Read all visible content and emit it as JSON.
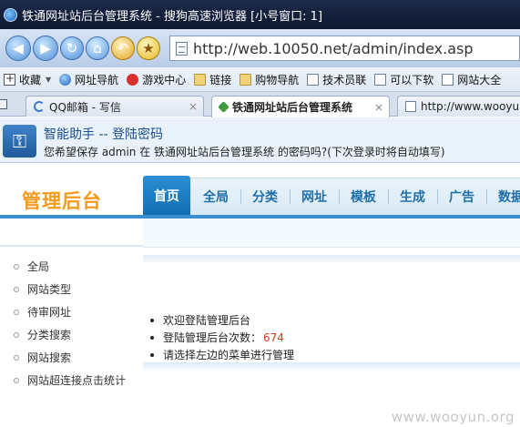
{
  "window": {
    "title": "铁通网址站后台管理系统 - 搜狗高速浏览器 [小号窗口: 1]"
  },
  "address_bar": {
    "url": "http://web.10050.net/admin/index.asp"
  },
  "bookmarks": [
    {
      "label": "收藏",
      "icon": "add-bookmark-icon"
    },
    {
      "label": "网址导航",
      "icon": "globe-icon"
    },
    {
      "label": "游戏中心",
      "icon": "game-icon"
    },
    {
      "label": "链接",
      "icon": "folder-icon"
    },
    {
      "label": "购物导航",
      "icon": "folder-icon"
    },
    {
      "label": "技术员联",
      "icon": "page-icon"
    },
    {
      "label": "可以下软",
      "icon": "page-icon"
    },
    {
      "label": "网站大全",
      "icon": "page-icon"
    }
  ],
  "tabs": [
    {
      "label": "QQ邮箱 - 写信",
      "active": false
    },
    {
      "label": "铁通网址站后台管理系统",
      "active": true
    },
    {
      "label": "http://www.wooyun.or",
      "active": false
    }
  ],
  "password_helper": {
    "title": "智能助手 -- 登陆密码",
    "message": "您希望保存 admin 在 铁通网址站后台管理系统 的密码吗?(下次登录时将自动填写)"
  },
  "admin": {
    "logo": "管理后台",
    "menu": [
      "首页",
      "全局",
      "分类",
      "网址",
      "模板",
      "生成",
      "广告",
      "数据"
    ],
    "active_menu": "首页",
    "sidebar": [
      "全局",
      "网站类型",
      "待审网址",
      "分类搜索",
      "网站搜索",
      "网站超连接点击统计"
    ],
    "info": {
      "welcome": "欢迎登陆管理后台",
      "login_count_label": "登陆管理后台次数：",
      "login_count": "674",
      "hint": "请选择左边的菜单进行管理"
    }
  },
  "watermark": "www.wooyun.org",
  "colors": {
    "accent": "#1a73b8",
    "logo": "#f39a1c",
    "count": "#d43b1c"
  }
}
